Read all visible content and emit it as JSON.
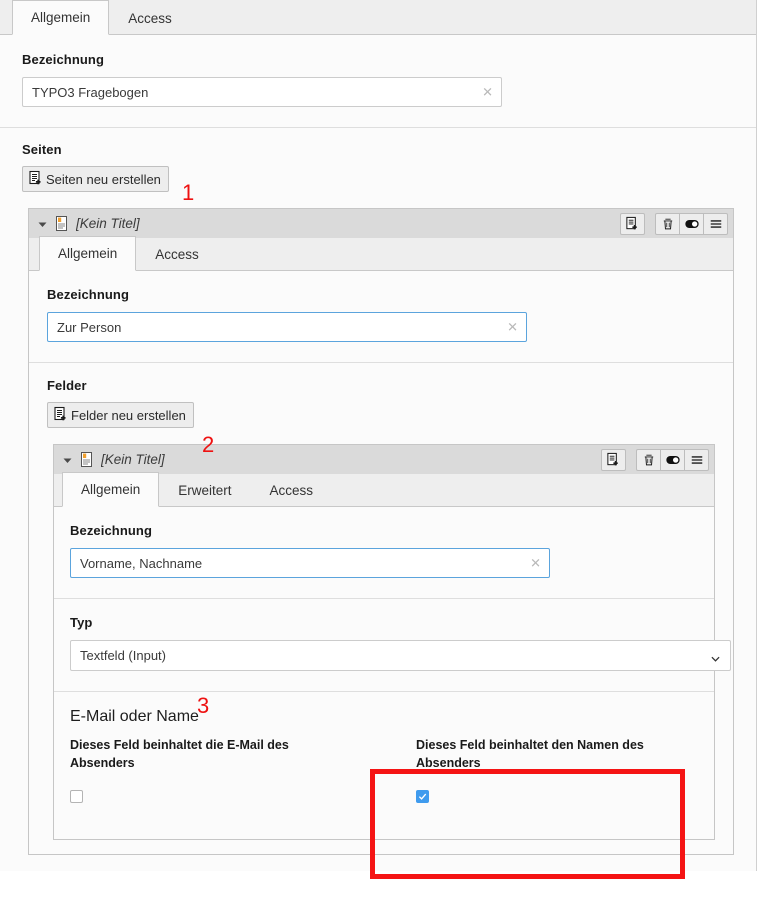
{
  "root_tabs": [
    {
      "label": "Allgemein",
      "active": true
    },
    {
      "label": "Access",
      "active": false
    }
  ],
  "root_form": {
    "bezeichnung_label": "Bezeichnung",
    "bezeichnung_value": "TYPO3 Fragebogen",
    "clear_icon": "clear-x-icon"
  },
  "pages_section": {
    "label": "Seiten",
    "create_button": "Seiten neu erstellen",
    "create_icon": "new-record-icon"
  },
  "page_record": {
    "title": "[Kein Titel]",
    "collapse_icon": "chevron-down-icon",
    "doc_icon": "page-document-icon",
    "actions": {
      "new": "new-record-icon",
      "delete": "trash-icon",
      "toggle": "hide-unhide-toggle-icon",
      "sort": "drag-handle-icon"
    },
    "tabs": [
      {
        "label": "Allgemein",
        "active": true
      },
      {
        "label": "Access",
        "active": false
      }
    ],
    "bezeichnung_label": "Bezeichnung",
    "bezeichnung_value": "Zur Person",
    "fields_section": {
      "label": "Felder",
      "create_button": "Felder neu erstellen",
      "create_icon": "new-record-icon"
    }
  },
  "field_record": {
    "title": "[Kein Titel]",
    "collapse_icon": "chevron-down-icon",
    "doc_icon": "field-document-icon",
    "actions": {
      "new": "new-record-icon",
      "delete": "trash-icon",
      "toggle": "hide-unhide-toggle-icon",
      "sort": "drag-handle-icon"
    },
    "tabs": [
      {
        "label": "Allgemein",
        "active": true
      },
      {
        "label": "Erweitert",
        "active": false
      },
      {
        "label": "Access",
        "active": false
      }
    ],
    "bezeichnung_label": "Bezeichnung",
    "bezeichnung_value": "Vorname, Nachname",
    "typ_label": "Typ",
    "typ_value": "Textfeld (Input)",
    "typ_caret_icon": "chevron-down-icon",
    "email_or_name": {
      "heading": "E-Mail oder Name",
      "left": {
        "label": "Dieses Feld beinhaltet die E-Mail des Absenders",
        "checked": false
      },
      "right": {
        "label": "Dieses Feld beinhaltet den Namen des Absenders",
        "checked": true
      }
    }
  },
  "annotations": {
    "one": "1",
    "two": "2",
    "three": "3",
    "highlight_color": "#f51414"
  }
}
